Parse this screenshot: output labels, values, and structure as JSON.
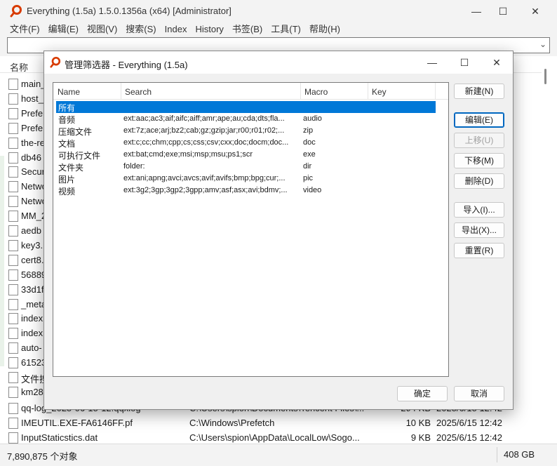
{
  "main": {
    "title": "Everything (1.5a) 1.5.0.1356a (x64) [Administrator]",
    "menu": [
      "文件(F)",
      "编辑(E)",
      "视图(V)",
      "搜索(S)",
      "Index",
      "History",
      "书签(B)",
      "工具(T)",
      "帮助(H)"
    ],
    "search_dropdown": "⌄",
    "column_name": "名称",
    "visible_names": [
      "main_",
      "host_",
      "Prefe",
      "Prefe",
      "the-re",
      "db46",
      "Secur",
      "Netwo",
      "Netwo",
      "MM_2",
      "aedb",
      "key3.",
      "cert8.",
      "56889",
      "33d1f",
      "_meta",
      "index",
      "index",
      "auto-",
      "61523",
      "文件搜",
      "km28"
    ],
    "bottom_rows": [
      {
        "name": "qq-log_2025-06-15-12.qqxlog",
        "path": "C:\\Users\\spion\\Documents\\Tencent Files\\...",
        "size": "294 KB",
        "date": "2025/6/15 12:42"
      },
      {
        "name": "IMEUTIL.EXE-FA6146FF.pf",
        "path": "C:\\Windows\\Prefetch",
        "size": "10 KB",
        "date": "2025/6/15 12:42"
      },
      {
        "name": "InputStaticstics.dat",
        "path": "C:\\Users\\spion\\AppData\\LocalLow\\Sogo...",
        "size": "9 KB",
        "date": "2025/6/15 12:42"
      }
    ],
    "status_count": "7,890,875 个对象",
    "status_disk": "408 GB"
  },
  "dialog": {
    "title": "管理筛选器 - Everything (1.5a)",
    "columns": {
      "name": "Name",
      "search": "Search",
      "macro": "Macro",
      "key": "Key"
    },
    "filters": [
      {
        "name": "所有",
        "search": "",
        "macro": "",
        "selected": true
      },
      {
        "name": "音频",
        "search": "ext:aac;ac3;aif;aifc;aiff;amr;ape;au;cda;dts;fla...",
        "macro": "audio"
      },
      {
        "name": "压缩文件",
        "search": "ext:7z;ace;arj;bz2;cab;gz;gzip;jar;r00;r01;r02;...",
        "macro": "zip"
      },
      {
        "name": "文档",
        "search": "ext:c;cc;chm;cpp;cs;css;csv;cxx;doc;docm;doc...",
        "macro": "doc"
      },
      {
        "name": "可执行文件",
        "search": "ext:bat;cmd;exe;msi;msp;msu;ps1;scr",
        "macro": "exe"
      },
      {
        "name": "文件夹",
        "search": "folder:",
        "macro": "dir"
      },
      {
        "name": "图片",
        "search": "ext:ani;apng;avci;avcs;avif;avifs;bmp;bpg;cur;...",
        "macro": "pic"
      },
      {
        "name": "视频",
        "search": "ext:3g2;3gp;3gp2;3gpp;amv;asf;asx;avi;bdmv;...",
        "macro": "video"
      }
    ],
    "buttons": {
      "new": "新建(N)",
      "edit": "编辑(E)",
      "move_up": "上移(U)",
      "move_down": "下移(M)",
      "delete": "删除(D)",
      "import": "导入(I)...",
      "export": "导出(X)...",
      "reset": "重置(R)",
      "ok": "确定",
      "cancel": "取消"
    }
  },
  "colors": {
    "selection": "#0078d7",
    "accent_icon": "#d83b01"
  }
}
